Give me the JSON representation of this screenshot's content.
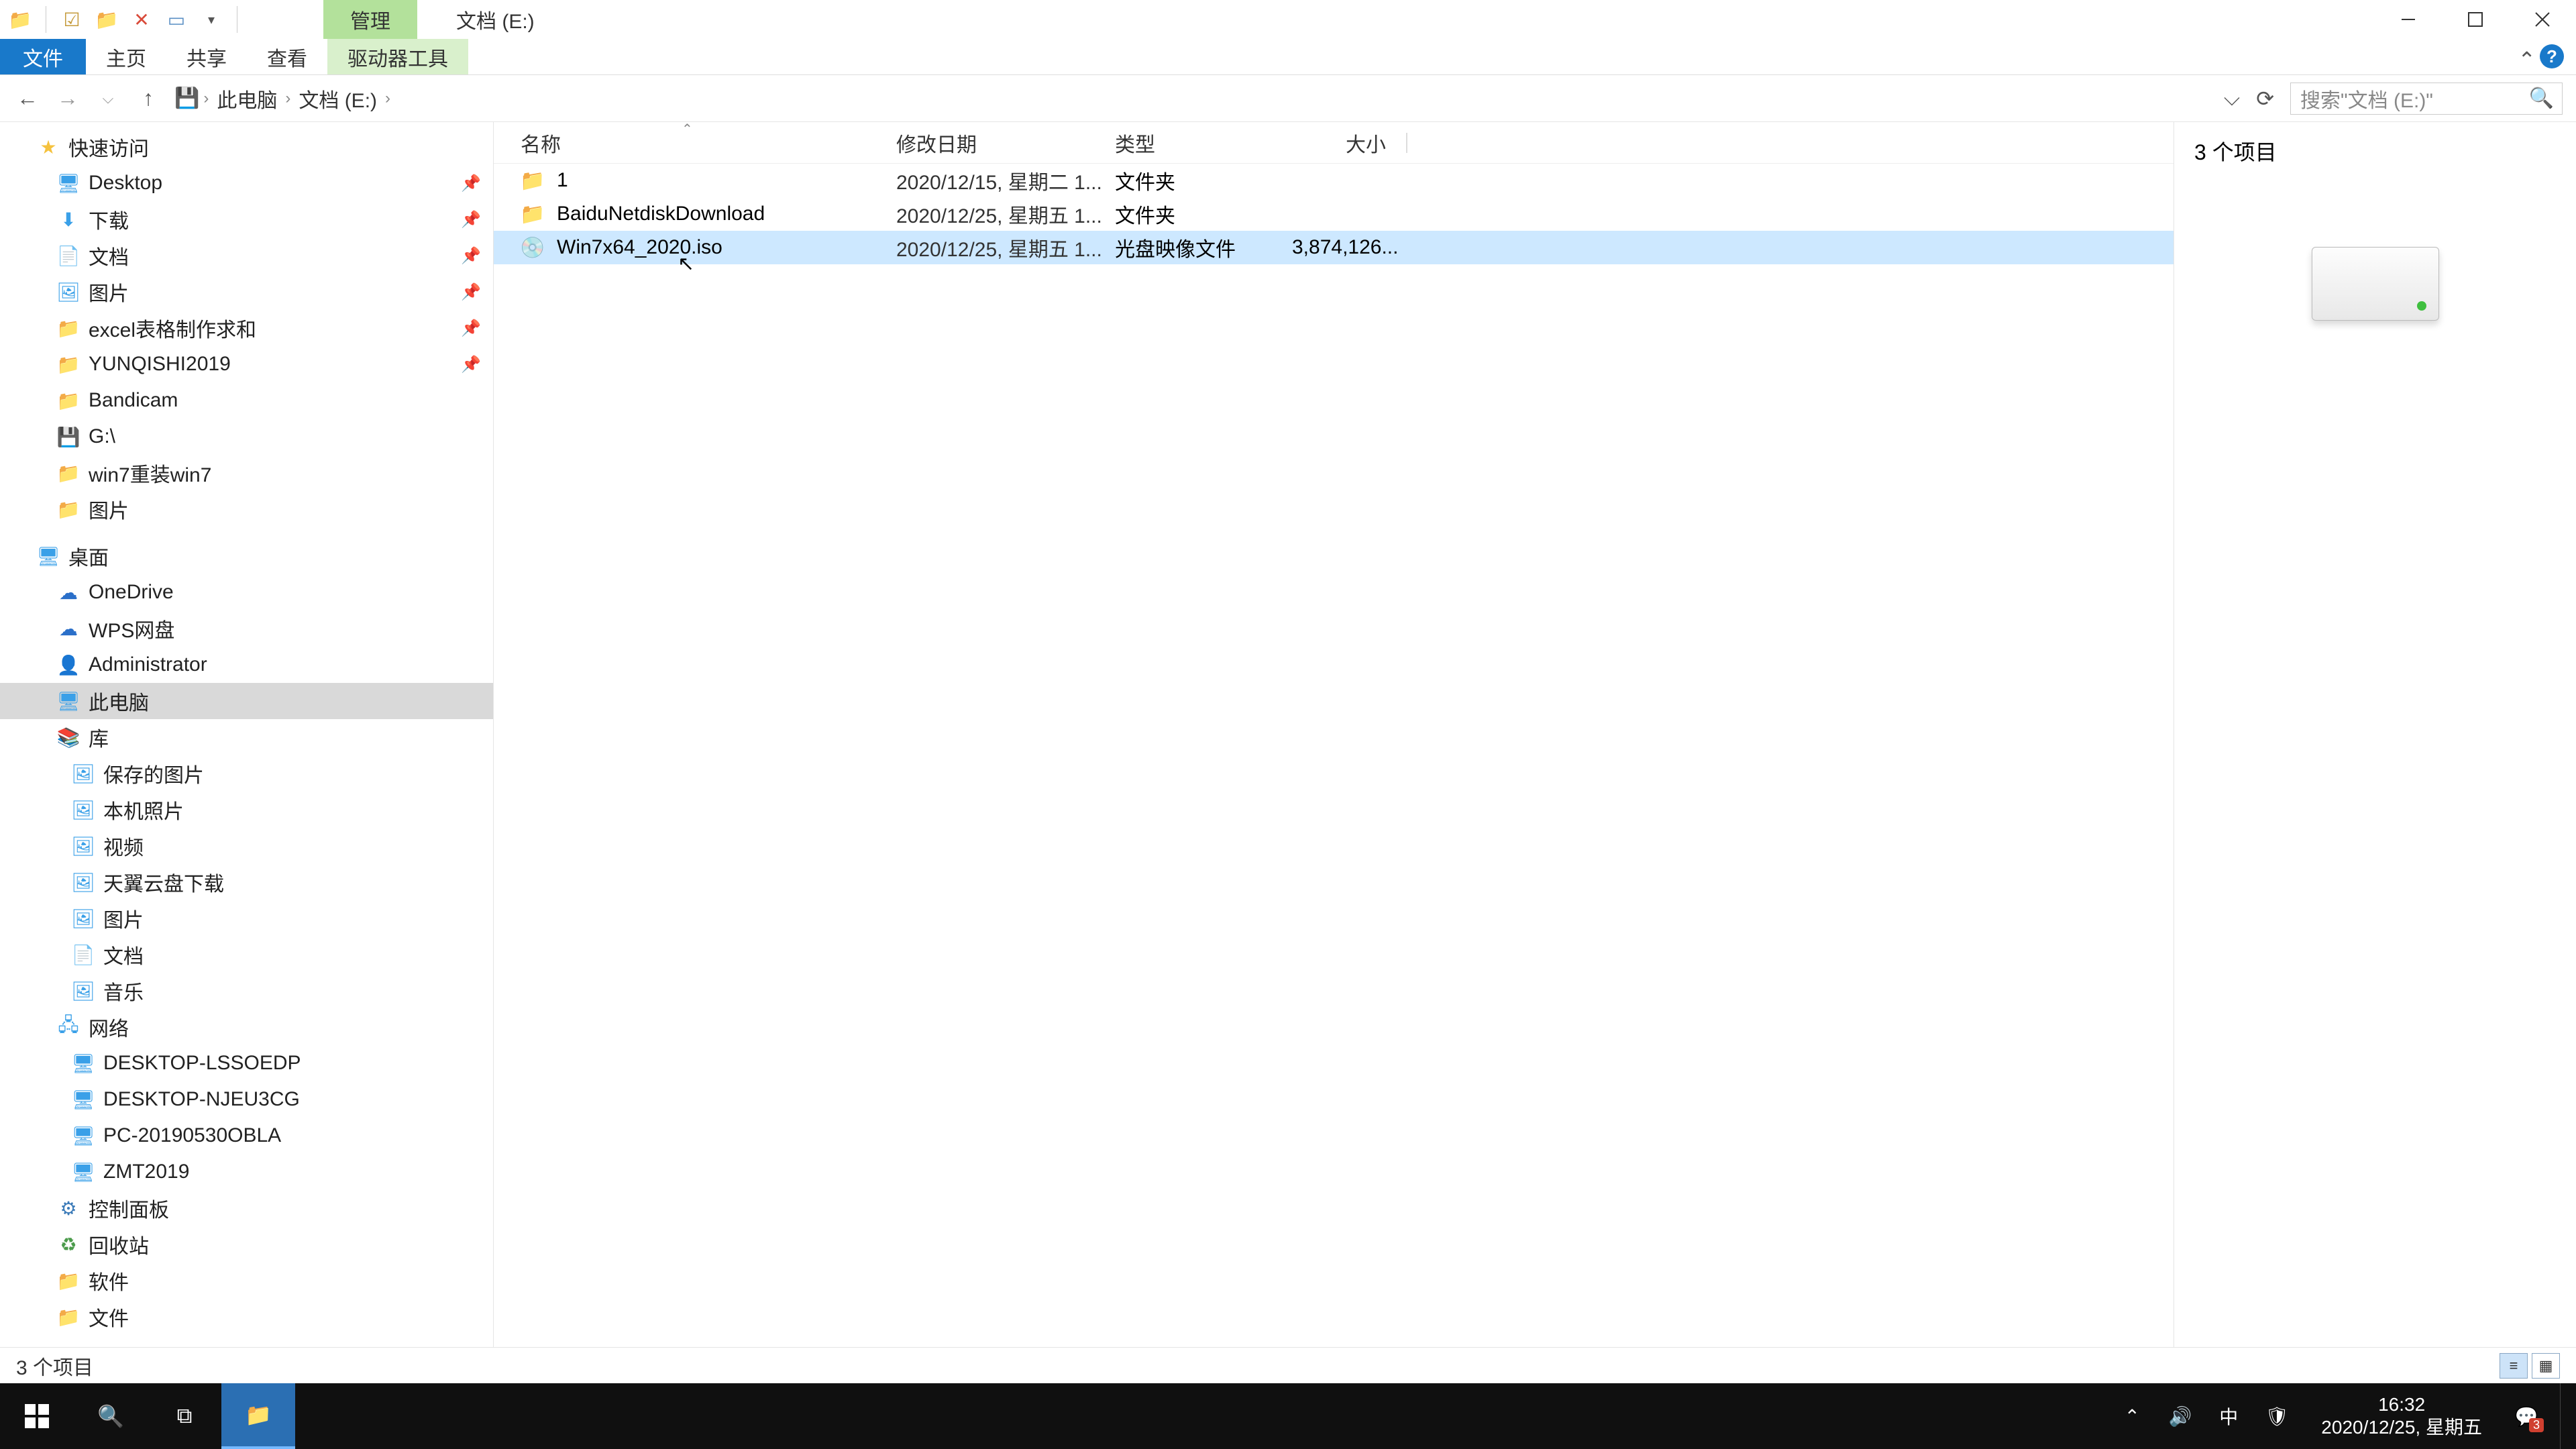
{
  "title_context_tab": "管理",
  "title_text": "文档 (E:)",
  "ribbon": {
    "file": "文件",
    "home": "主页",
    "share": "共享",
    "view": "查看",
    "drive_tools": "驱动器工具"
  },
  "breadcrumb": {
    "pc": "此电脑",
    "loc": "文档 (E:)"
  },
  "search": {
    "placeholder": "搜索\"文档 (E:)\""
  },
  "columns": {
    "name": "名称",
    "date": "修改日期",
    "type": "类型",
    "size": "大小"
  },
  "rows": [
    {
      "name": "1",
      "date": "2020/12/15, 星期二 1...",
      "type": "文件夹",
      "size": "",
      "icon": "folder"
    },
    {
      "name": "BaiduNetdiskDownload",
      "date": "2020/12/25, 星期五 1...",
      "type": "文件夹",
      "size": "",
      "icon": "folder"
    },
    {
      "name": "Win7x64_2020.iso",
      "date": "2020/12/25, 星期五 1...",
      "type": "光盘映像文件",
      "size": "3,874,126...",
      "icon": "iso"
    }
  ],
  "nav": {
    "quick_access": "快速访问",
    "qa_items": [
      {
        "label": "Desktop",
        "icon": "desktop"
      },
      {
        "label": "下载",
        "icon": "down"
      },
      {
        "label": "文档",
        "icon": "doc"
      },
      {
        "label": "图片",
        "icon": "pic"
      },
      {
        "label": "excel表格制作求和",
        "icon": "folder"
      },
      {
        "label": "YUNQISHI2019",
        "icon": "folder"
      },
      {
        "label": "Bandicam",
        "icon": "folder"
      },
      {
        "label": "G:\\",
        "icon": "drive"
      },
      {
        "label": "win7重装win7",
        "icon": "folder"
      },
      {
        "label": "图片",
        "icon": "folder"
      }
    ],
    "desktop": "桌面",
    "desktop_items": [
      {
        "label": "OneDrive",
        "icon": "onedrive"
      },
      {
        "label": "WPS网盘",
        "icon": "onedrive"
      },
      {
        "label": "Administrator",
        "icon": "user"
      },
      {
        "label": "此电脑",
        "icon": "pc",
        "selected": true
      },
      {
        "label": "库",
        "icon": "lib"
      }
    ],
    "lib_items": [
      {
        "label": "保存的图片",
        "icon": "pic"
      },
      {
        "label": "本机照片",
        "icon": "pic"
      },
      {
        "label": "视频",
        "icon": "pic"
      },
      {
        "label": "天翼云盘下载",
        "icon": "pic"
      },
      {
        "label": "图片",
        "icon": "pic"
      },
      {
        "label": "文档",
        "icon": "doc"
      },
      {
        "label": "音乐",
        "icon": "pic"
      }
    ],
    "network": "网络",
    "net_items": [
      {
        "label": "DESKTOP-LSSOEDP"
      },
      {
        "label": "DESKTOP-NJEU3CG"
      },
      {
        "label": "PC-20190530OBLA"
      },
      {
        "label": "ZMT2019"
      }
    ],
    "control_panel": "控制面板",
    "recycle": "回收站",
    "software": "软件",
    "docs": "文件"
  },
  "preview": {
    "count": "3 个项目"
  },
  "status": {
    "left": "3 个项目"
  },
  "taskbar": {
    "time": "16:32",
    "date": "2020/12/25, 星期五",
    "ime": "中",
    "badge": "3"
  }
}
